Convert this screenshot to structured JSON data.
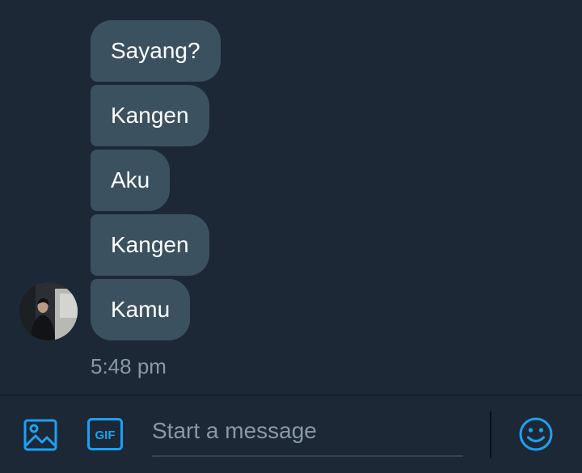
{
  "conversation": {
    "messages": [
      {
        "text": "Sayang?"
      },
      {
        "text": "Kangen"
      },
      {
        "text": "Aku"
      },
      {
        "text": "Kangen"
      },
      {
        "text": "Kamu"
      }
    ],
    "timestamp": "5:48 pm",
    "sender_avatar": "avatar-photo"
  },
  "composer": {
    "placeholder": "Start a message",
    "value": "",
    "media_icon": "image-icon",
    "gif_icon": "gif-icon",
    "gif_label": "GIF",
    "emoji_icon": "smiley-icon"
  },
  "colors": {
    "background": "#1d2836",
    "bubble": "#3b5160",
    "accent": "#1da1f2",
    "muted_text": "#8899a6"
  }
}
